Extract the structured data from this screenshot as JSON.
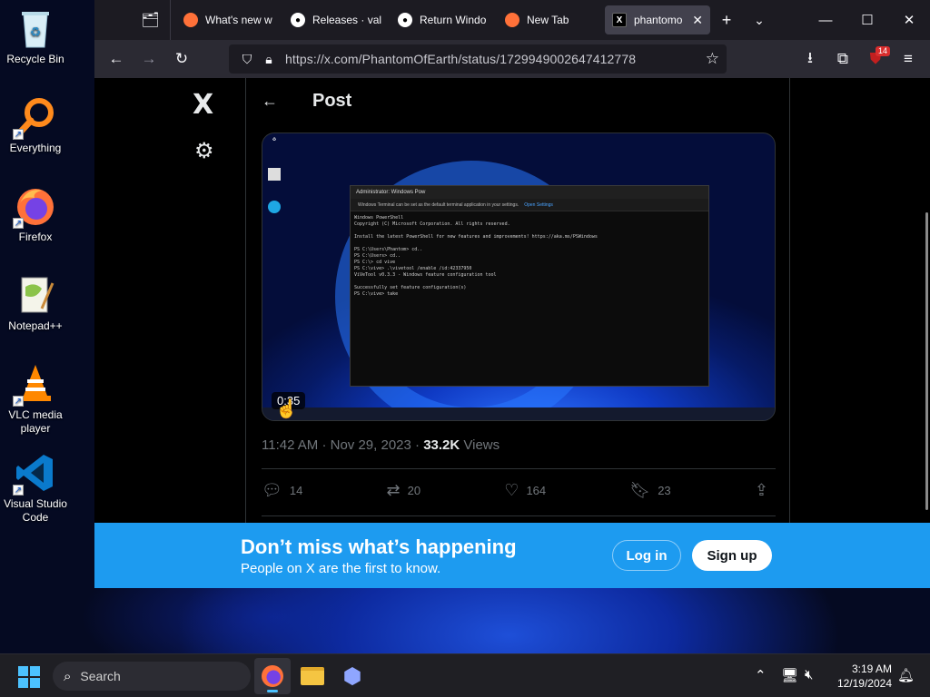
{
  "desktop": {
    "icons": [
      {
        "label": "Recycle Bin",
        "icon": "recycle-bin-icon"
      },
      {
        "label": "Everything",
        "icon": "everything-search-icon"
      },
      {
        "label": "Firefox",
        "icon": "firefox-icon"
      },
      {
        "label": "Notepad++",
        "icon": "notepadpp-icon"
      },
      {
        "label": "VLC media player",
        "icon": "vlc-icon"
      },
      {
        "label": "Visual Studio Code",
        "icon": "vscode-icon"
      }
    ]
  },
  "browser": {
    "tabs": [
      {
        "label": "What's new w",
        "icon": "firefox-icon"
      },
      {
        "label": "Releases · val",
        "icon": "github-icon"
      },
      {
        "label": "Return Windo",
        "icon": "github-icon"
      },
      {
        "label": "New Tab",
        "icon": "firefox-icon"
      },
      {
        "label": "phantomo",
        "icon": "x-icon",
        "active": true
      }
    ],
    "url": "https://x.com/PhantomOfEarth/status/1729949002647412778",
    "extension_badge": "14"
  },
  "x_page": {
    "logo": "X",
    "header_title": "Post",
    "video": {
      "duration": "0:35",
      "terminal_tab": "Administrator: Windows Pow",
      "terminal_notice": "Windows Terminal can be set as the default terminal application in your settings.",
      "terminal_notice_link": "Open Settings",
      "terminal_lines": "Windows PowerShell\nCopyright (C) Microsoft Corporation. All rights reserved.\n\nInstall the latest PowerShell for new features and improvements! https://aka.ms/PSWindows\n\nPS C:\\Users\\Phantom> cd..\nPS C:\\Users> cd..\nPS C:\\> cd vive\nPS C:\\vive> .\\vivetool /enable /id:42337950\nViVeTool v0.3.3 - Windows feature configuration tool\n\nSuccessfully set feature configuration(s)\nPS C:\\vive> take"
    },
    "time": "11:42 AM",
    "date": "Nov 29, 2023",
    "views_count": "33.2K",
    "views_label": "Views",
    "actions": {
      "replies": "14",
      "reposts": "20",
      "likes": "164",
      "bookmarks": "23"
    },
    "banner": {
      "headline": "Don’t miss what’s happening",
      "subtext": "People on X are the first to know.",
      "login": "Log in",
      "signup": "Sign up"
    }
  },
  "taskbar": {
    "search_placeholder": "Search",
    "time": "3:19 AM",
    "date": "12/19/2024"
  },
  "colors": {
    "x_blue": "#1d9bf0",
    "taskbar_accent": "#4cc2ff"
  }
}
